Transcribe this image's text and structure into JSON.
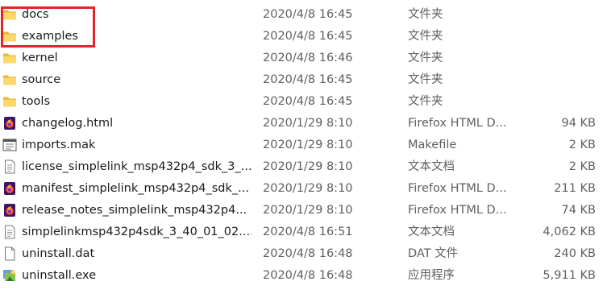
{
  "files": [
    {
      "name": "docs",
      "modified": "2020/4/8 16:45",
      "type": "文件夹",
      "size": "",
      "icon": "folder-icon"
    },
    {
      "name": "examples",
      "modified": "2020/4/8 16:45",
      "type": "文件夹",
      "size": "",
      "icon": "folder-icon"
    },
    {
      "name": "kernel",
      "modified": "2020/4/8 16:46",
      "type": "文件夹",
      "size": "",
      "icon": "folder-icon"
    },
    {
      "name": "source",
      "modified": "2020/4/8 16:45",
      "type": "文件夹",
      "size": "",
      "icon": "folder-icon"
    },
    {
      "name": "tools",
      "modified": "2020/4/8 16:45",
      "type": "文件夹",
      "size": "",
      "icon": "folder-icon"
    },
    {
      "name": "changelog.html",
      "modified": "2020/1/29 8:10",
      "type": "Firefox HTML D...",
      "size": "94 KB",
      "icon": "firefox-html-icon"
    },
    {
      "name": "imports.mak",
      "modified": "2020/1/29 8:10",
      "type": "Makefile",
      "size": "2 KB",
      "icon": "makefile-icon"
    },
    {
      "name": "license_simplelink_msp432p4_sdk_3_...",
      "modified": "2020/1/29 8:10",
      "type": "文本文档",
      "size": "2 KB",
      "icon": "text-file-icon"
    },
    {
      "name": "manifest_simplelink_msp432p4_sdk_...",
      "modified": "2020/1/29 8:10",
      "type": "Firefox HTML D...",
      "size": "211 KB",
      "icon": "firefox-html-icon"
    },
    {
      "name": "release_notes_simplelink_msp432p4...",
      "modified": "2020/1/29 8:10",
      "type": "Firefox HTML D...",
      "size": "74 KB",
      "icon": "firefox-html-icon"
    },
    {
      "name": "simplelinkmsp432p4sdk_3_40_01_02....",
      "modified": "2020/4/8 16:51",
      "type": "文本文档",
      "size": "4,062 KB",
      "icon": "text-file-icon"
    },
    {
      "name": "uninstall.dat",
      "modified": "2020/4/8 16:48",
      "type": "DAT 文件",
      "size": "240 KB",
      "icon": "blank-file-icon"
    },
    {
      "name": "uninstall.exe",
      "modified": "2020/4/8 16:48",
      "type": "应用程序",
      "size": "5,911 KB",
      "icon": "installer-icon"
    }
  ],
  "highlight_color": "#e0262a"
}
